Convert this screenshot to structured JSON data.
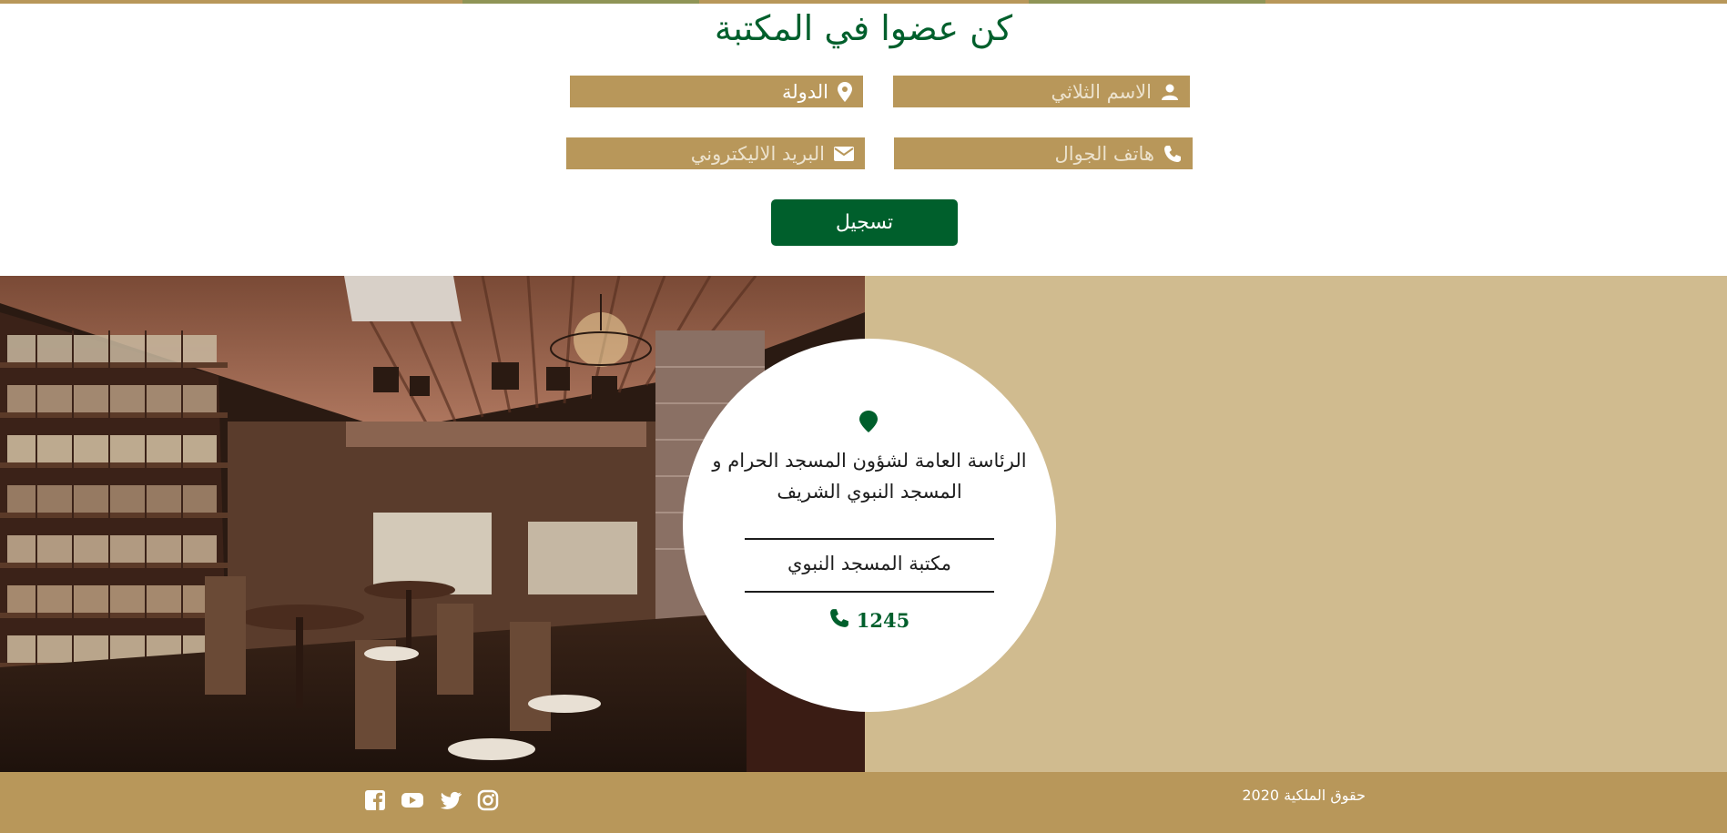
{
  "form": {
    "title": "كن عضوا في المكتبة",
    "fields": {
      "name": "الاسم الثلاثي",
      "country": "الدولة",
      "phone": "هاتف الجوال",
      "email": "البريد الاليكتروني"
    },
    "submit_label": "تسجيل"
  },
  "contact": {
    "address": "الرئاسة العامة لشؤون المسجد الحرام و المسجد النبوي الشريف",
    "library_name": "مكتبة المسجد النبوي",
    "phone_number": "1245",
    "icons": [
      "map-pin-icon",
      "phone-icon"
    ]
  },
  "footer": {
    "copyright": "حقوق الملكية 2020",
    "social": [
      "instagram-icon",
      "twitter-icon",
      "youtube-icon",
      "facebook-icon"
    ]
  },
  "colors": {
    "brand_green": "#005f2c",
    "gold": "#b8975a",
    "sand": "#d0bb8f"
  }
}
